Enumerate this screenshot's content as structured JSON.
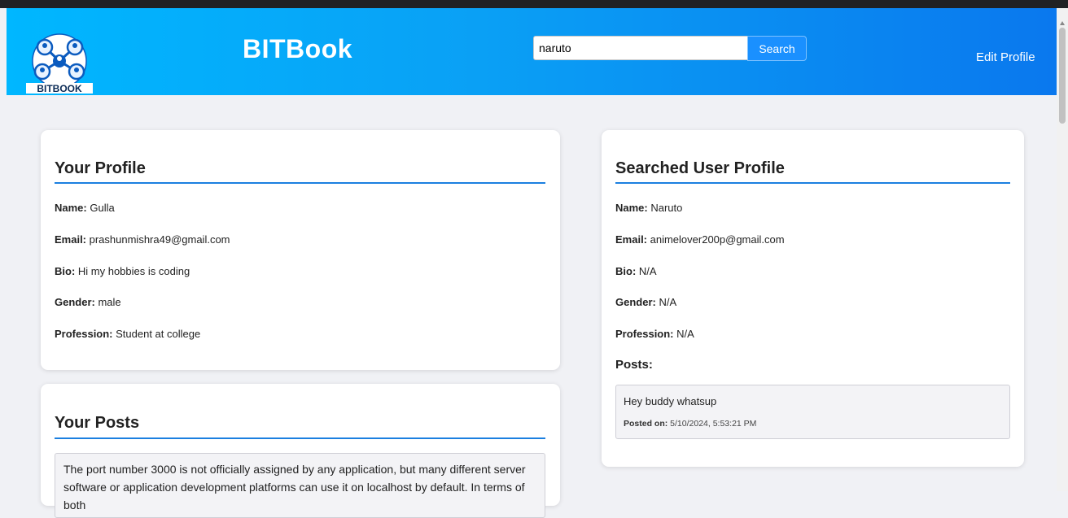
{
  "header": {
    "logo_text": "BITBOOK",
    "brand": "BITBook",
    "search": {
      "value": "naruto",
      "placeholder": ""
    },
    "search_label": "Search",
    "edit_profile_label": "Edit Profile"
  },
  "your_profile": {
    "title": "Your Profile",
    "fields": [
      {
        "label": "Name:",
        "value": " Gulla"
      },
      {
        "label": "Email:",
        "value": " prashunmishra49@gmail.com"
      },
      {
        "label": "Bio:",
        "value": " Hi my hobbies is coding"
      },
      {
        "label": "Gender:",
        "value": " male"
      },
      {
        "label": "Profession:",
        "value": " Student at college"
      }
    ]
  },
  "your_posts": {
    "title": "Your Posts",
    "posts": [
      {
        "text": "The port number 3000 is not officially assigned by any application, but many different server software or application development platforms can use it on localhost by default. In terms of both"
      }
    ]
  },
  "searched_profile": {
    "title": "Searched User Profile",
    "fields": [
      {
        "label": "Name:",
        "value": " Naruto"
      },
      {
        "label": "Email:",
        "value": " animelover200p@gmail.com"
      },
      {
        "label": "Bio:",
        "value": " N/A"
      },
      {
        "label": "Gender:",
        "value": " N/A"
      },
      {
        "label": "Profession:",
        "value": " N/A"
      }
    ],
    "posts_heading": "Posts:",
    "posts": [
      {
        "text": "Hey buddy whatsup",
        "meta_label": "Posted on:",
        "meta_value": " 5/10/2024, 5:53:21 PM"
      }
    ]
  },
  "colors": {
    "accent": "#1b7fe0",
    "header_start": "#00b7ff",
    "header_end": "#0a78ee",
    "page_bg": "#f0f1f5"
  }
}
